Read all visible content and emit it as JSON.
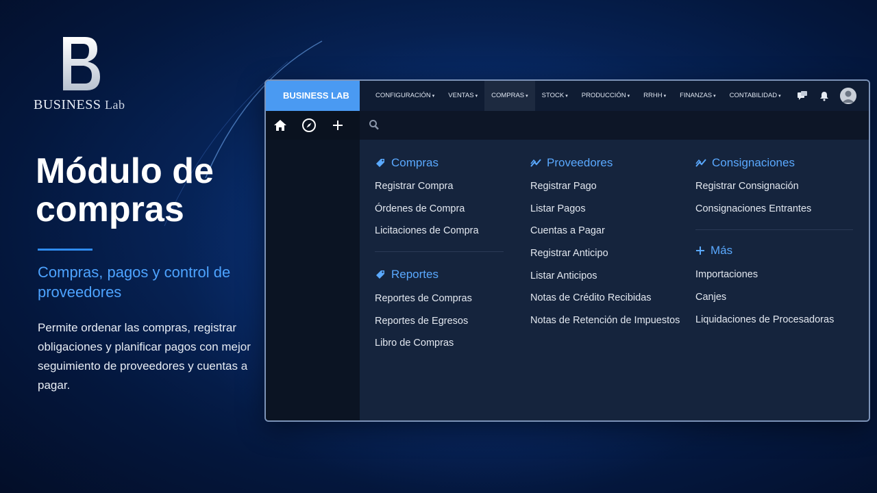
{
  "branding": {
    "logo_word": "BUSINESS",
    "logo_suffix": "Lab"
  },
  "hero": {
    "title_line1": "Módulo de",
    "title_line2": "compras",
    "subtitle": "Compras, pagos y control de proveedores",
    "description": "Permite ordenar las compras, registrar obligaciones y planificar pagos con mejor seguimiento de proveedores y cuentas a pagar.",
    "accent_color": "#2f8cf0"
  },
  "app": {
    "brand": "BUSINESS LAB",
    "menu": [
      {
        "label": "CONFIGURACIÓN",
        "active": false
      },
      {
        "label": "VENTAS",
        "active": false
      },
      {
        "label": "COMPRAS",
        "active": true
      },
      {
        "label": "STOCK",
        "active": false
      },
      {
        "label": "PRODUCCIÓN",
        "active": false
      },
      {
        "label": "RRHH",
        "active": false
      },
      {
        "label": "FINANZAS",
        "active": false
      },
      {
        "label": "CONTABILIDAD",
        "active": false
      }
    ],
    "caret": "▾",
    "top_icons": [
      "chat-icon",
      "notification-bell-icon",
      "user-avatar"
    ],
    "toolbar_icons": [
      "home-icon",
      "compass-icon",
      "plus-icon"
    ],
    "search_icon": "search-icon",
    "columns": [
      {
        "sections": [
          {
            "title": "Compras",
            "icon": "tag-icon",
            "links": [
              "Registrar Compra",
              "Órdenes de Compra",
              "Licitaciones de Compra"
            ]
          },
          {
            "title": "Reportes",
            "icon": "tag-icon",
            "links": [
              "Reportes de Compras",
              "Reportes de Egresos",
              "Libro de Compras"
            ]
          }
        ]
      },
      {
        "sections": [
          {
            "title": "Proveedores",
            "icon": "trend-icon",
            "links": [
              "Registrar Pago",
              "Listar Pagos",
              "Cuentas a Pagar",
              "Registrar Anticipo",
              "Listar Anticipos",
              "Notas de Crédito Recibidas",
              "Notas de Retención de Impuestos"
            ]
          }
        ]
      },
      {
        "sections": [
          {
            "title": "Consignaciones",
            "icon": "trend-icon",
            "links": [
              "Registrar Consignación",
              "Consignaciones Entrantes"
            ]
          },
          {
            "title": "Más",
            "icon": "plus-icon",
            "links": [
              "Importaciones",
              "Canjes",
              "Liquidaciones de Procesadoras"
            ]
          }
        ]
      }
    ]
  }
}
